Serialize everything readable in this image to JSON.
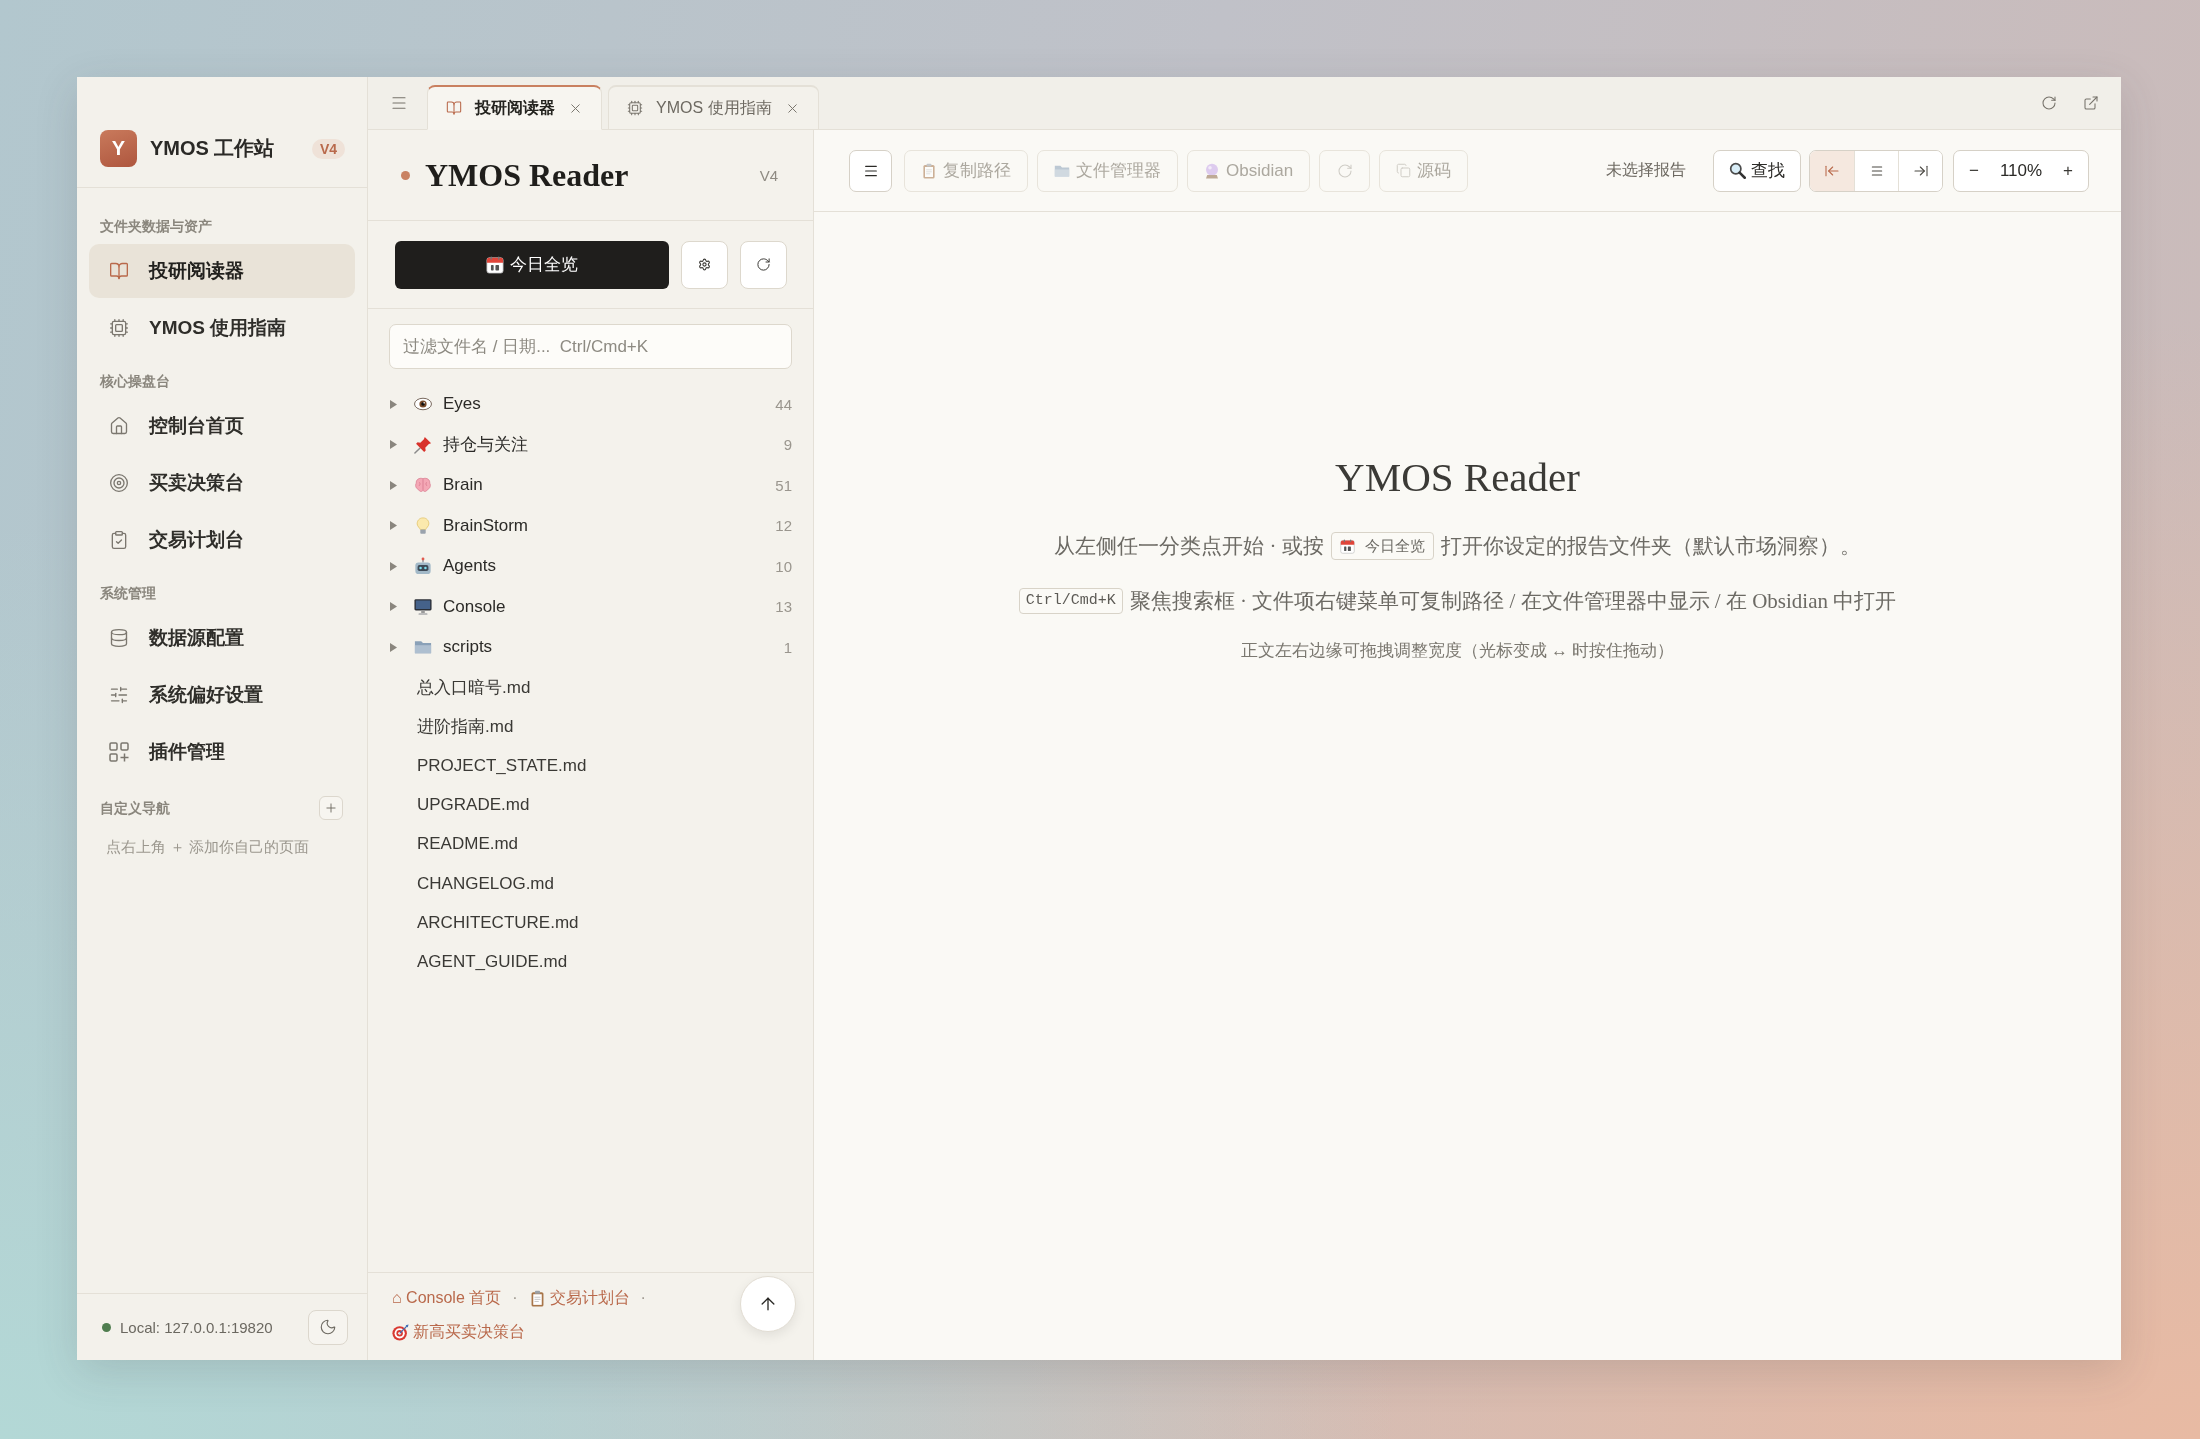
{
  "sidebar": {
    "brand": {
      "avatar": "Y",
      "title": "YMOS 工作站",
      "badge": "V4"
    },
    "sections": [
      {
        "label": "文件夹数据与资产",
        "items": [
          {
            "label": "投研阅读器",
            "kind": "book",
            "selected": true
          },
          {
            "label": "YMOS 使用指南",
            "kind": "chip",
            "selected": false
          }
        ]
      },
      {
        "label": "核心操盘台",
        "items": [
          {
            "label": "控制台首页",
            "kind": "home",
            "selected": false
          },
          {
            "label": "买卖决策台",
            "kind": "target",
            "selected": false
          },
          {
            "label": "交易计划台",
            "kind": "clipboard",
            "selected": false
          }
        ]
      },
      {
        "label": "系统管理",
        "items": [
          {
            "label": "数据源配置",
            "kind": "database",
            "selected": false
          },
          {
            "label": "系统偏好设置",
            "kind": "sliders",
            "selected": false
          },
          {
            "label": "插件管理",
            "kind": "plugins",
            "selected": false
          }
        ]
      }
    ],
    "custom_nav": {
      "label": "自定义导航",
      "hint": "点右上角 ＋ 添加你自己的页面"
    },
    "status": {
      "text": "Local: 127.0.0.1:19820"
    }
  },
  "tabs": [
    {
      "label": "投研阅读器",
      "kind": "book",
      "selected": true
    },
    {
      "label": "YMOS 使用指南",
      "kind": "chip",
      "selected": false
    }
  ],
  "file_panel": {
    "title": "YMOS Reader",
    "version": "V4",
    "today_button": "今日全览",
    "search": {
      "placeholder": "过滤文件名 / 日期...  Ctrl/Cmd+K"
    },
    "folders": [
      {
        "name": "Eyes",
        "kind": "eye",
        "count": "44",
        "expanded": false
      },
      {
        "name": "持仓与关注",
        "kind": "pin",
        "count": "9",
        "expanded": false
      },
      {
        "name": "Brain",
        "kind": "brain",
        "count": "51",
        "expanded": false
      },
      {
        "name": "BrainStorm",
        "kind": "bulb",
        "count": "12",
        "expanded": false
      },
      {
        "name": "Agents",
        "kind": "robot",
        "count": "10",
        "expanded": false
      },
      {
        "name": "Console",
        "kind": "monitor",
        "count": "13",
        "expanded": false
      },
      {
        "name": "scripts",
        "kind": "folder",
        "count": "1",
        "expanded": false
      }
    ],
    "files": [
      "总入口暗号.md",
      "进阶指南.md",
      "PROJECT_STATE.md",
      "UPGRADE.md",
      "README.md",
      "CHANGELOG.md",
      "ARCHITECTURE.md",
      "AGENT_GUIDE.md"
    ],
    "footer_links": [
      {
        "label": "⌂ Console 首页",
        "kind": "plain",
        "separator": "·"
      },
      {
        "label": "交易计划台",
        "kind": "clipboard",
        "separator": "·"
      },
      {
        "label": "新高买卖决策台",
        "kind": "dart"
      }
    ]
  },
  "toolbar": {
    "buttons": [
      {
        "label": "复制路径",
        "kind": "clipboard",
        "disabled": true
      },
      {
        "label": "文件管理器",
        "kind": "folder",
        "disabled": true
      },
      {
        "label": "Obsidian",
        "kind": "crystal",
        "disabled": true
      },
      {
        "kind": "refresh",
        "disabled": true
      },
      {
        "label": "源码",
        "kind": "copy",
        "disabled": true
      }
    ],
    "status": "未选择报告",
    "find_button": "查找",
    "alignment": [
      {
        "kind": "left",
        "selected": true
      },
      {
        "kind": "center",
        "selected": false
      },
      {
        "kind": "right",
        "selected": false
      }
    ],
    "zoom": {
      "minus": "−",
      "value": "110%",
      "plus": "+"
    }
  },
  "welcome": {
    "title": "YMOS Reader",
    "line_1": {
      "before": "从左侧任一分类点开始 · 或按",
      "chip": "今日全览",
      "after": "打开你设定的报告文件夹（默认市场洞察）。"
    },
    "line_2": {
      "key": "Ctrl/Cmd+K",
      "text": "聚焦搜索框 · 文件项右键菜单可复制路径 / 在文件管理器中显示 / 在 Obsidian 中打开"
    },
    "note": "正文左右边缘可拖拽调整宽度（光标变成 ↔ 时按住拖动）"
  }
}
